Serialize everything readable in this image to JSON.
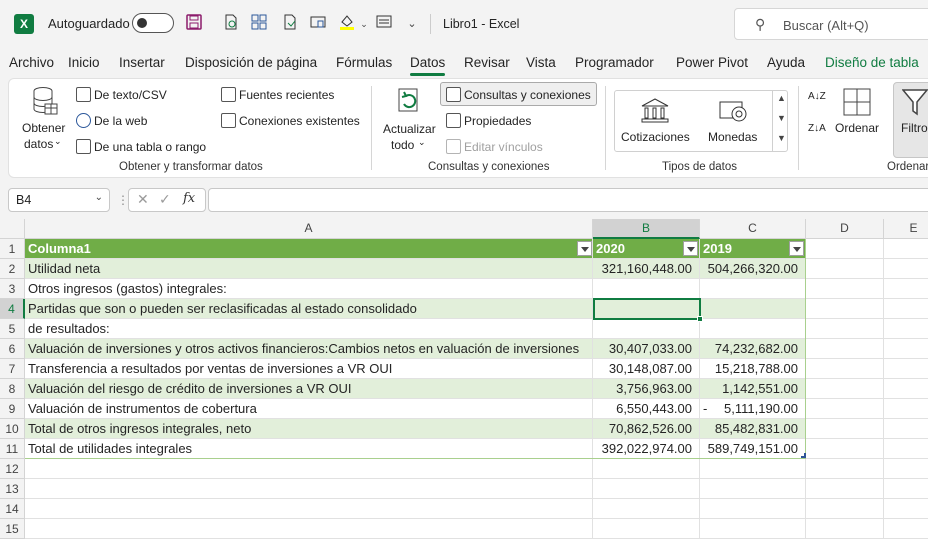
{
  "titlebar": {
    "app_icon": "excel-logo-icon",
    "logo_letter": "X",
    "autosave_label": "Autoguardado",
    "file_title": "Libro1  -  Excel",
    "search_placeholder": "Buscar (Alt+Q)"
  },
  "tabs": [
    "Archivo",
    "Inicio",
    "Insertar",
    "Disposición de página",
    "Fórmulas",
    "Datos",
    "Revisar",
    "Vista",
    "Programador",
    "Power Pivot",
    "Ayuda",
    "Diseño de tabla"
  ],
  "active_tab": "Datos",
  "ribbon": {
    "obtener_datos": "Obtener",
    "obtener_datos_2": "datos",
    "de_texto_csv": "De texto/CSV",
    "de_la_web": "De la web",
    "de_una_tabla": "De una tabla o rango",
    "fuentes_recientes": "Fuentes recientes",
    "conexiones_existentes": "Conexiones existentes",
    "group_obtener": "Obtener y transformar datos",
    "actualizar": "Actualizar",
    "actualizar_2": "todo",
    "consultas": "Consultas y conexiones",
    "propiedades": "Propiedades",
    "editar_vinculos": "Editar vínculos",
    "group_consultas": "Consultas y conexiones",
    "cotizaciones": "Cotizaciones",
    "monedas": "Monedas",
    "group_tipos": "Tipos de datos",
    "sort_az": "A↓Z",
    "sort_za": "Z↓A",
    "ordenar": "Ordenar",
    "filtro": "Filtro",
    "group_ordenar": "Ordenar"
  },
  "formula_bar": {
    "name_box": "B4",
    "cancel_glyph": "✕",
    "enter_glyph": "✓",
    "fx": "fx",
    "value": ""
  },
  "columns": [
    "A",
    "B",
    "C",
    "D",
    "E"
  ],
  "rows": [
    "1",
    "2",
    "3",
    "4",
    "5",
    "6",
    "7",
    "8",
    "9",
    "10",
    "11",
    "12",
    "13",
    "14",
    "15"
  ],
  "table": {
    "header": [
      "Columna1",
      "2020",
      "2019"
    ],
    "rows": [
      [
        "Utilidad neta",
        "321,160,448.00",
        "504,266,320.00"
      ],
      [
        "Otros ingresos (gastos) integrales:",
        "",
        ""
      ],
      [
        "Partidas que son o pueden ser reclasificadas al estado consolidado",
        "",
        ""
      ],
      [
        "de resultados:",
        "",
        ""
      ],
      [
        "Valuación de inversiones y otros activos financieros:Cambios netos en valuación de inversiones",
        "30,407,033.00",
        "74,232,682.00"
      ],
      [
        "Transferencia a resultados por ventas de inversiones a VR OUI",
        "30,148,087.00",
        "15,218,788.00"
      ],
      [
        "Valuación del riesgo de crédito de inversiones a VR OUI",
        "3,756,963.00",
        "1,142,551.00"
      ],
      [
        "Valuación de instrumentos de cobertura",
        "6,550,443.00",
        "5,111,190.00"
      ],
      [
        "Total de otros ingresos integrales, neto",
        "70,862,526.00",
        "85,482,831.00"
      ],
      [
        "Total de utilidades integrales",
        "392,022,974.00",
        "589,749,151.00"
      ]
    ],
    "row9_prefix": "-"
  },
  "colors": {
    "header_green": "#70ad47",
    "band_green": "#e2efda",
    "excel_green": "#107c41"
  }
}
